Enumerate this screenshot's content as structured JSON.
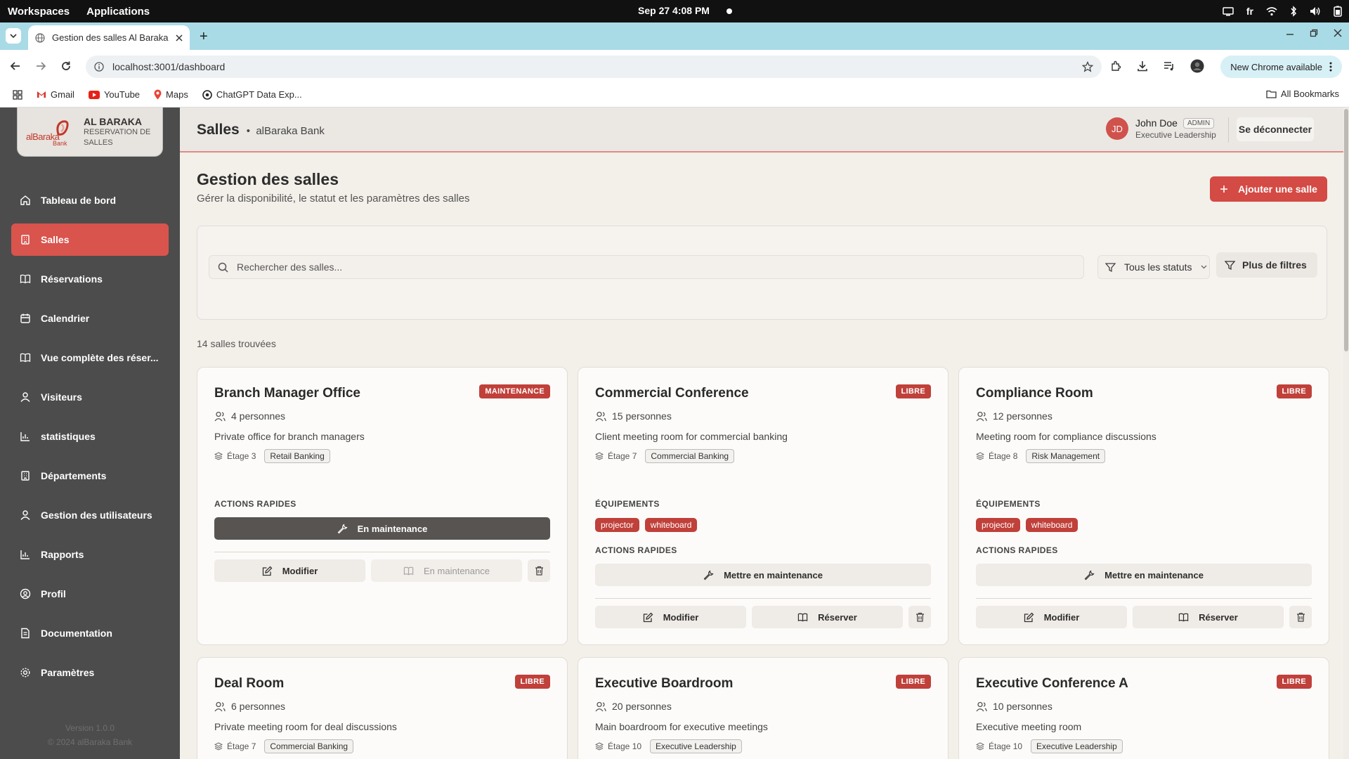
{
  "os": {
    "workspaces": "Workspaces",
    "applications": "Applications",
    "datetime": "Sep 27  4:08 PM",
    "lang": "fr"
  },
  "browser": {
    "tab_title": "Gestion des salles Al Baraka",
    "url": "localhost:3001/dashboard",
    "new_chrome": "New Chrome available",
    "bookmarks": [
      "Gmail",
      "YouTube",
      "Maps",
      "ChatGPT Data Exp..."
    ],
    "all_bookmarks": "All Bookmarks"
  },
  "brand": {
    "logo_text": "alBaraka",
    "logo_sub": "Bank",
    "name": "AL BARAKA",
    "subtitle": "RESERVATION DE SALLES"
  },
  "sidebar": {
    "items": [
      {
        "label": "Tableau de bord",
        "icon": "home-icon"
      },
      {
        "label": "Salles",
        "icon": "building-icon"
      },
      {
        "label": "Réservations",
        "icon": "book-icon"
      },
      {
        "label": "Calendrier",
        "icon": "calendar-icon"
      },
      {
        "label": "Vue complète des réser...",
        "icon": "book-open-icon"
      },
      {
        "label": "Visiteurs",
        "icon": "user-icon"
      },
      {
        "label": "statistiques",
        "icon": "bar-chart-icon"
      },
      {
        "label": "Départements",
        "icon": "building-icon"
      },
      {
        "label": "Gestion des utilisateurs",
        "icon": "user-icon"
      },
      {
        "label": "Rapports",
        "icon": "bar-chart-icon"
      },
      {
        "label": "Profil",
        "icon": "user-circle-icon"
      },
      {
        "label": "Documentation",
        "icon": "document-icon"
      },
      {
        "label": "Paramètres",
        "icon": "gear-icon"
      }
    ],
    "version": "Version 1.0.0",
    "copyright": "© 2024 alBaraka Bank"
  },
  "header": {
    "title": "Salles",
    "bank": "alBaraka Bank",
    "user_initials": "JD",
    "user_name": "John Doe",
    "role": "ADMIN",
    "department": "Executive Leadership",
    "logout": "Se déconnecter"
  },
  "page": {
    "title": "Gestion des salles",
    "subtitle": "Gérer la disponibilité, le statut et les paramètres des salles",
    "add_button": "Ajouter une salle",
    "search_placeholder": "Rechercher des salles...",
    "status_filter": "Tous les statuts",
    "more_filters": "Plus de filtres",
    "count": "14 salles trouvées"
  },
  "labels": {
    "equipment": "ÉQUIPEMENTS",
    "quick_actions": "ACTIONS RAPIDES",
    "maintenance_on": "En maintenance",
    "set_maintenance": "Mettre en maintenance",
    "edit": "Modifier",
    "reserve": "Réserver"
  },
  "rooms": [
    {
      "name": "Branch Manager Office",
      "status": "MAINTENANCE",
      "capacity": "4 personnes",
      "description": "Private office for branch managers",
      "floor": "Étage 3",
      "department": "Retail Banking",
      "equipment": []
    },
    {
      "name": "Commercial Conference",
      "status": "LIBRE",
      "capacity": "15 personnes",
      "description": "Client meeting room for commercial banking",
      "floor": "Étage 7",
      "department": "Commercial Banking",
      "equipment": [
        "projector",
        "whiteboard"
      ]
    },
    {
      "name": "Compliance Room",
      "status": "LIBRE",
      "capacity": "12 personnes",
      "description": "Meeting room for compliance discussions",
      "floor": "Étage 8",
      "department": "Risk Management",
      "equipment": [
        "projector",
        "whiteboard"
      ]
    },
    {
      "name": "Deal Room",
      "status": "LIBRE",
      "capacity": "6 personnes",
      "description": "Private meeting room for deal discussions",
      "floor": "Étage 7",
      "department": "Commercial Banking",
      "equipment": []
    },
    {
      "name": "Executive Boardroom",
      "status": "LIBRE",
      "capacity": "20 personnes",
      "description": "Main boardroom for executive meetings",
      "floor": "Étage 10",
      "department": "Executive Leadership",
      "equipment": []
    },
    {
      "name": "Executive Conference A",
      "status": "LIBRE",
      "capacity": "10 personnes",
      "description": "Executive meeting room",
      "floor": "Étage 10",
      "department": "Executive Leadership",
      "equipment": []
    }
  ],
  "colors": {
    "accent": "#d44a44",
    "sidebar": "#4c4c4c",
    "status_badge": "#c0403a"
  }
}
